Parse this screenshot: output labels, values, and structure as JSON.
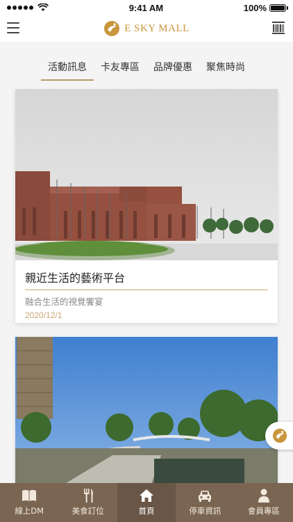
{
  "status": {
    "time": "9:41 AM",
    "battery": "100%"
  },
  "header": {
    "logo_text": "E SKY MALL"
  },
  "tabs": [
    {
      "label": "活動訊息",
      "active": true
    },
    {
      "label": "卡友專區",
      "active": false
    },
    {
      "label": "品牌優惠",
      "active": false
    },
    {
      "label": "聚焦時尚",
      "active": false
    }
  ],
  "cards": [
    {
      "title": "親近生活的藝術平台",
      "subtitle": "融合生活的視覺饗宴",
      "date": "2020/12/1"
    }
  ],
  "bottom_nav": [
    {
      "label": "線上DM",
      "icon": "book-icon",
      "active": false
    },
    {
      "label": "美食訂位",
      "icon": "fork-knife-icon",
      "active": false
    },
    {
      "label": "首頁",
      "icon": "home-icon",
      "active": true
    },
    {
      "label": "停車資訊",
      "icon": "car-icon",
      "active": false
    },
    {
      "label": "會員專區",
      "icon": "user-icon",
      "active": false
    }
  ],
  "colors": {
    "gold": "#c8963c",
    "nav_bg": "#7a6553",
    "tab_underline": "#b89a6a"
  }
}
